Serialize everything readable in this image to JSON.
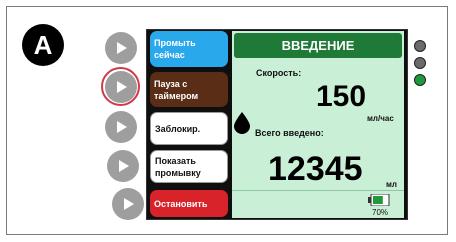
{
  "badge": "A",
  "buttons": {
    "flush_now": "Промыть сейчас",
    "pause_timer": "Пауза с таймером",
    "lock": "Заблокир.",
    "show_flush": "Показать промывку",
    "stop": "Остановить"
  },
  "screen": {
    "title": "ВВЕДЕНИЕ",
    "speed_label": "Скорость:",
    "speed_value": "150",
    "speed_unit": "мл/час",
    "total_label": "Всего введено:",
    "total_value": "12345",
    "total_unit": "мл",
    "battery_pct": "70%",
    "battery_level": 0.7
  },
  "colors": {
    "title_bar": "#1f7a38",
    "screen_bg": "#c9f0d7",
    "btn_blue": "#2aa8ec",
    "btn_brown": "#5a2d17",
    "btn_red": "#d8232a",
    "light_active": "#1e9a3c",
    "light_inactive": "#6b6b6b",
    "highlight_ring": "#d03a4a"
  },
  "indicator_lights": [
    "inactive",
    "inactive",
    "active"
  ]
}
